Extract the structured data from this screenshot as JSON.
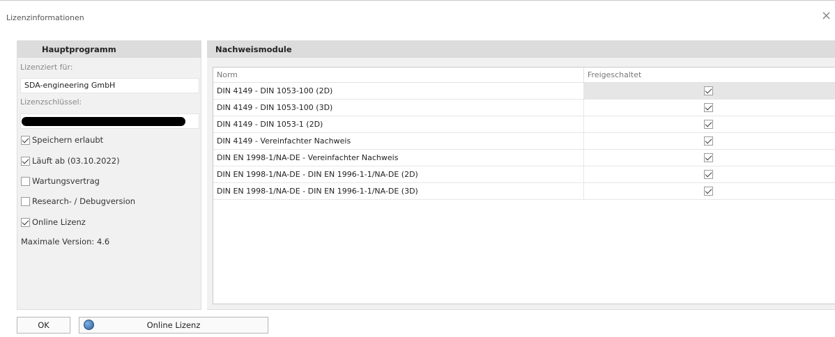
{
  "window": {
    "title": "Lizenzinformationen",
    "close_glyph": "×"
  },
  "main_program": {
    "header": "Hauptprogramm",
    "licensed_for_label": "Lizenziert für:",
    "licensed_for_value": "SDA-engineering GmbH",
    "license_key_label": "Lizenzschlüssel:",
    "checkboxes": [
      {
        "label": "Speichern erlaubt",
        "checked": true
      },
      {
        "label": "Läuft ab (03.10.2022)",
        "checked": true
      },
      {
        "label": "Wartungsvertrag",
        "checked": false
      },
      {
        "label": "Research- / Debugversion",
        "checked": false
      },
      {
        "label": "Online Lizenz",
        "checked": true
      }
    ],
    "max_version": "Maximale Version: 4.6"
  },
  "modules": {
    "header": "Nachweismodule",
    "columns": {
      "norm": "Norm",
      "enabled": "Freigeschaltet"
    },
    "rows": [
      {
        "norm": "DIN 4149 - DIN 1053-100 (2D)",
        "enabled": true
      },
      {
        "norm": "DIN 4149 - DIN 1053-100 (3D)",
        "enabled": true
      },
      {
        "norm": "DIN 4149 - DIN 1053-1 (2D)",
        "enabled": true
      },
      {
        "norm": "DIN 4149 - Vereinfachter Nachweis",
        "enabled": true
      },
      {
        "norm": "DIN EN 1998-1/NA-DE - Vereinfachter Nachweis",
        "enabled": true
      },
      {
        "norm": "DIN EN 1998-1/NA-DE - DIN EN 1996-1-1/NA-DE (2D)",
        "enabled": true
      },
      {
        "norm": "DIN EN 1998-1/NA-DE - DIN EN 1996-1-1/NA-DE (3D)",
        "enabled": true
      }
    ]
  },
  "buttons": {
    "ok": "OK",
    "online_license": "Online Lizenz"
  },
  "icons": {
    "online_license": "globe-icon",
    "close": "close-icon"
  }
}
